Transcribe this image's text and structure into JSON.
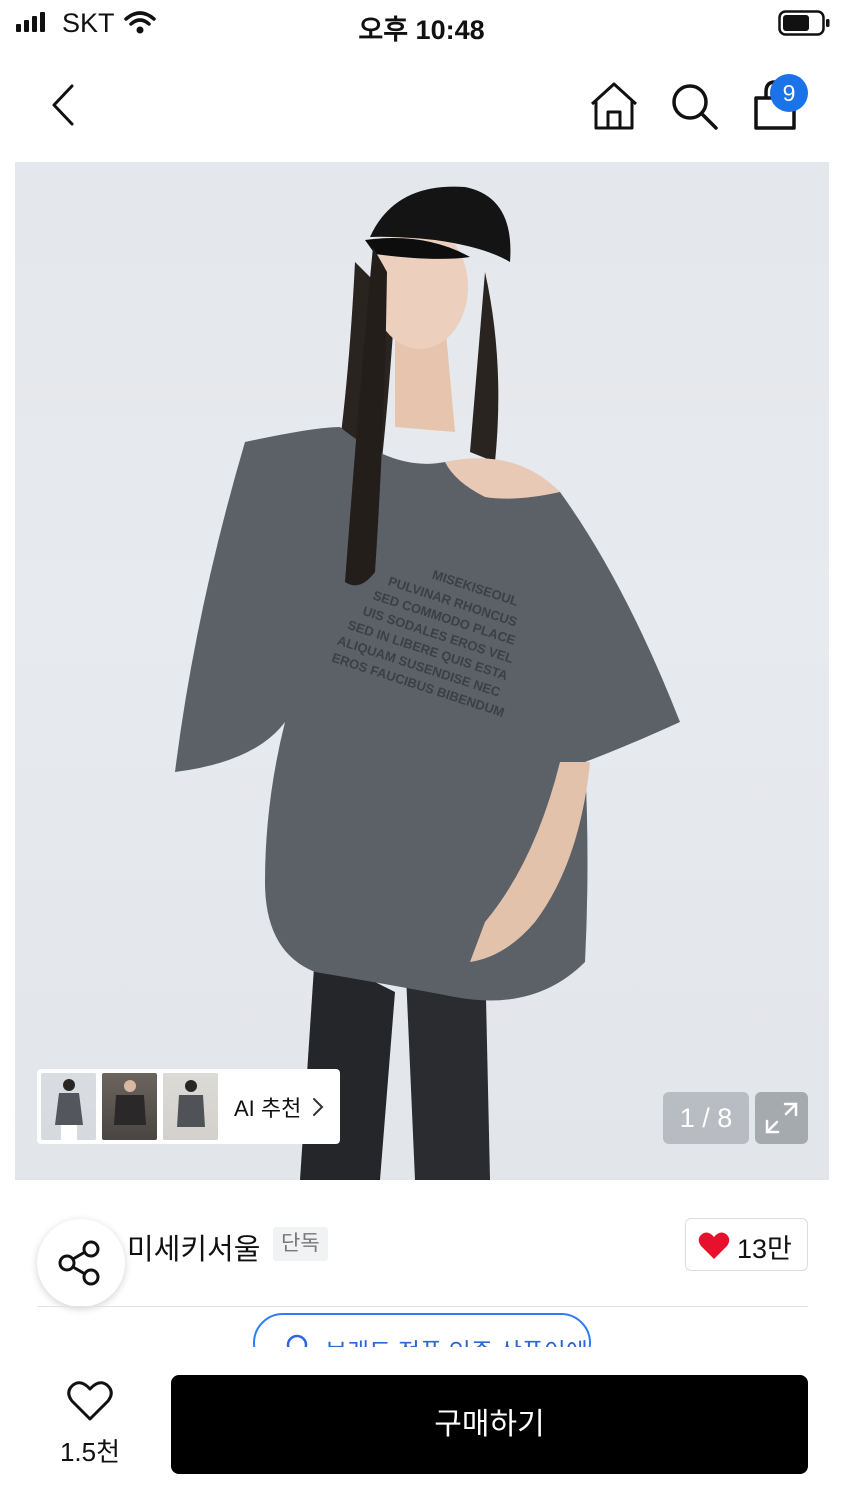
{
  "status_bar": {
    "carrier": "SKT",
    "time": "오후 10:48"
  },
  "nav": {
    "cart_count": "9"
  },
  "gallery": {
    "ai_recommend_label": "AI 추천",
    "page_indicator": "1 / 8"
  },
  "brand": {
    "name": "미세키서울",
    "tag": "단독",
    "like_count": "13만"
  },
  "notice": {
    "genuine_text": "브랜드 정품 인증 상품이에요"
  },
  "bottom_bar": {
    "wish_count": "1.5천",
    "buy_label": "구매하기"
  },
  "colors": {
    "accent_blue": "#1a73e8",
    "heart_red": "#e8112d",
    "buy_button": "#000000"
  },
  "icons": [
    "back-icon",
    "home-icon",
    "search-icon",
    "cart-icon",
    "share-icon",
    "heart-icon",
    "expand-icon",
    "chevron-right-icon"
  ]
}
